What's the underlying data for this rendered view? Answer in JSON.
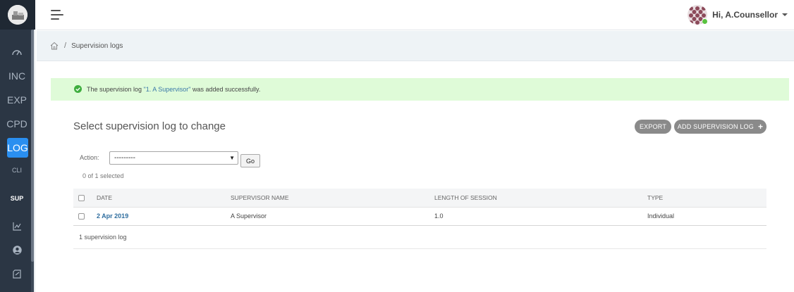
{
  "sidebar": {
    "items": [
      {
        "label": ""
      },
      {
        "label": "INC"
      },
      {
        "label": "EXP"
      },
      {
        "label": "CPD"
      },
      {
        "label": "LOG"
      },
      {
        "label": "CLI"
      },
      {
        "label": "SUP"
      },
      {
        "label": ""
      },
      {
        "label": ""
      },
      {
        "label": ""
      }
    ],
    "icons": [
      "dashboard-icon",
      "chart-icon",
      "user-circle-icon",
      "notes-icon"
    ]
  },
  "header": {
    "greeting": "Hi, A.Counsellor"
  },
  "breadcrumb": {
    "separator": "/",
    "current": "Supervision logs"
  },
  "alert": {
    "prefix": "The supervision log ",
    "link": "\"1. A Supervisor\"",
    "suffix": " was added successfully."
  },
  "main": {
    "title": "Select supervision log to change",
    "export_label": "EXPORT",
    "add_label": "ADD SUPERVISION LOG",
    "action_label": "Action:",
    "action_value": "---------",
    "go_label": "Go",
    "selected_count": "0 of 1 selected",
    "columns": {
      "date": "Date",
      "supervisor": "Supervisor name",
      "length": "Length of session",
      "type": "Type"
    },
    "rows": [
      {
        "date": "2 Apr 2019",
        "supervisor": "A Supervisor",
        "length": "1.0",
        "type": "Individual"
      }
    ],
    "footer_count": "1 supervision log"
  },
  "colors": {
    "sidebar_bg": "#2b3644",
    "active_nav": "#2a8ff0",
    "success_bg": "#dffbd8",
    "link": "#2f6e9f",
    "pill_button": "#8a8a8a"
  }
}
